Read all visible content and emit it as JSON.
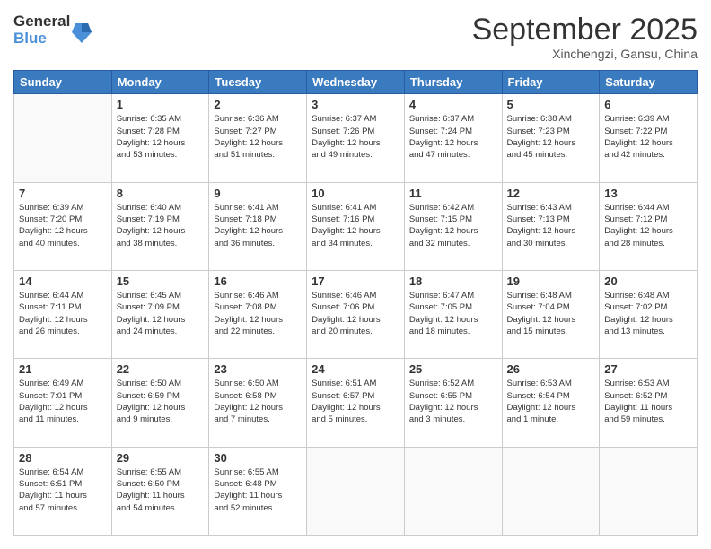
{
  "logo": {
    "general": "General",
    "blue": "Blue"
  },
  "title": "September 2025",
  "subtitle": "Xinchengzi, Gansu, China",
  "days_of_week": [
    "Sunday",
    "Monday",
    "Tuesday",
    "Wednesday",
    "Thursday",
    "Friday",
    "Saturday"
  ],
  "weeks": [
    [
      {
        "day": "",
        "info": ""
      },
      {
        "day": "1",
        "info": "Sunrise: 6:35 AM\nSunset: 7:28 PM\nDaylight: 12 hours\nand 53 minutes."
      },
      {
        "day": "2",
        "info": "Sunrise: 6:36 AM\nSunset: 7:27 PM\nDaylight: 12 hours\nand 51 minutes."
      },
      {
        "day": "3",
        "info": "Sunrise: 6:37 AM\nSunset: 7:26 PM\nDaylight: 12 hours\nand 49 minutes."
      },
      {
        "day": "4",
        "info": "Sunrise: 6:37 AM\nSunset: 7:24 PM\nDaylight: 12 hours\nand 47 minutes."
      },
      {
        "day": "5",
        "info": "Sunrise: 6:38 AM\nSunset: 7:23 PM\nDaylight: 12 hours\nand 45 minutes."
      },
      {
        "day": "6",
        "info": "Sunrise: 6:39 AM\nSunset: 7:22 PM\nDaylight: 12 hours\nand 42 minutes."
      }
    ],
    [
      {
        "day": "7",
        "info": "Sunrise: 6:39 AM\nSunset: 7:20 PM\nDaylight: 12 hours\nand 40 minutes."
      },
      {
        "day": "8",
        "info": "Sunrise: 6:40 AM\nSunset: 7:19 PM\nDaylight: 12 hours\nand 38 minutes."
      },
      {
        "day": "9",
        "info": "Sunrise: 6:41 AM\nSunset: 7:18 PM\nDaylight: 12 hours\nand 36 minutes."
      },
      {
        "day": "10",
        "info": "Sunrise: 6:41 AM\nSunset: 7:16 PM\nDaylight: 12 hours\nand 34 minutes."
      },
      {
        "day": "11",
        "info": "Sunrise: 6:42 AM\nSunset: 7:15 PM\nDaylight: 12 hours\nand 32 minutes."
      },
      {
        "day": "12",
        "info": "Sunrise: 6:43 AM\nSunset: 7:13 PM\nDaylight: 12 hours\nand 30 minutes."
      },
      {
        "day": "13",
        "info": "Sunrise: 6:44 AM\nSunset: 7:12 PM\nDaylight: 12 hours\nand 28 minutes."
      }
    ],
    [
      {
        "day": "14",
        "info": "Sunrise: 6:44 AM\nSunset: 7:11 PM\nDaylight: 12 hours\nand 26 minutes."
      },
      {
        "day": "15",
        "info": "Sunrise: 6:45 AM\nSunset: 7:09 PM\nDaylight: 12 hours\nand 24 minutes."
      },
      {
        "day": "16",
        "info": "Sunrise: 6:46 AM\nSunset: 7:08 PM\nDaylight: 12 hours\nand 22 minutes."
      },
      {
        "day": "17",
        "info": "Sunrise: 6:46 AM\nSunset: 7:06 PM\nDaylight: 12 hours\nand 20 minutes."
      },
      {
        "day": "18",
        "info": "Sunrise: 6:47 AM\nSunset: 7:05 PM\nDaylight: 12 hours\nand 18 minutes."
      },
      {
        "day": "19",
        "info": "Sunrise: 6:48 AM\nSunset: 7:04 PM\nDaylight: 12 hours\nand 15 minutes."
      },
      {
        "day": "20",
        "info": "Sunrise: 6:48 AM\nSunset: 7:02 PM\nDaylight: 12 hours\nand 13 minutes."
      }
    ],
    [
      {
        "day": "21",
        "info": "Sunrise: 6:49 AM\nSunset: 7:01 PM\nDaylight: 12 hours\nand 11 minutes."
      },
      {
        "day": "22",
        "info": "Sunrise: 6:50 AM\nSunset: 6:59 PM\nDaylight: 12 hours\nand 9 minutes."
      },
      {
        "day": "23",
        "info": "Sunrise: 6:50 AM\nSunset: 6:58 PM\nDaylight: 12 hours\nand 7 minutes."
      },
      {
        "day": "24",
        "info": "Sunrise: 6:51 AM\nSunset: 6:57 PM\nDaylight: 12 hours\nand 5 minutes."
      },
      {
        "day": "25",
        "info": "Sunrise: 6:52 AM\nSunset: 6:55 PM\nDaylight: 12 hours\nand 3 minutes."
      },
      {
        "day": "26",
        "info": "Sunrise: 6:53 AM\nSunset: 6:54 PM\nDaylight: 12 hours\nand 1 minute."
      },
      {
        "day": "27",
        "info": "Sunrise: 6:53 AM\nSunset: 6:52 PM\nDaylight: 11 hours\nand 59 minutes."
      }
    ],
    [
      {
        "day": "28",
        "info": "Sunrise: 6:54 AM\nSunset: 6:51 PM\nDaylight: 11 hours\nand 57 minutes."
      },
      {
        "day": "29",
        "info": "Sunrise: 6:55 AM\nSunset: 6:50 PM\nDaylight: 11 hours\nand 54 minutes."
      },
      {
        "day": "30",
        "info": "Sunrise: 6:55 AM\nSunset: 6:48 PM\nDaylight: 11 hours\nand 52 minutes."
      },
      {
        "day": "",
        "info": ""
      },
      {
        "day": "",
        "info": ""
      },
      {
        "day": "",
        "info": ""
      },
      {
        "day": "",
        "info": ""
      }
    ]
  ]
}
